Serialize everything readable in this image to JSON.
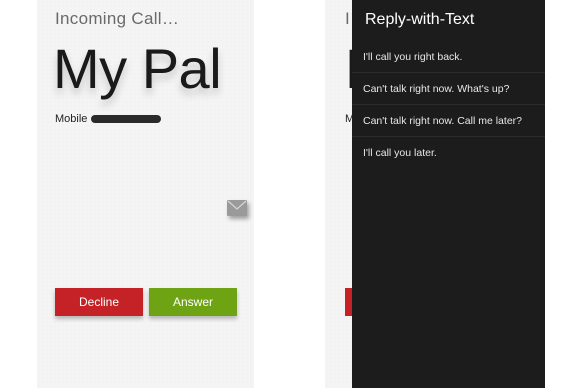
{
  "incoming_screen": {
    "status_label": "Incoming Call…",
    "caller_name": "My Pal",
    "phone_type": "Mobile",
    "decline_label": "Decline",
    "answer_label": "Answer"
  },
  "background_screen": {
    "caller_initial": "M",
    "incoming_initial": "I",
    "phone_type_initial": "M"
  },
  "reply_drawer": {
    "title": "Reply-with-Text",
    "options": [
      "I'll call you right back.",
      "Can't talk right now. What's up?",
      "Can't talk right now. Call me later?",
      "I'll call you later."
    ]
  },
  "colors": {
    "decline": "#c42226",
    "answer": "#6ea414",
    "drawer_bg": "#1c1c1c"
  },
  "icons": [
    "message-icon"
  ]
}
